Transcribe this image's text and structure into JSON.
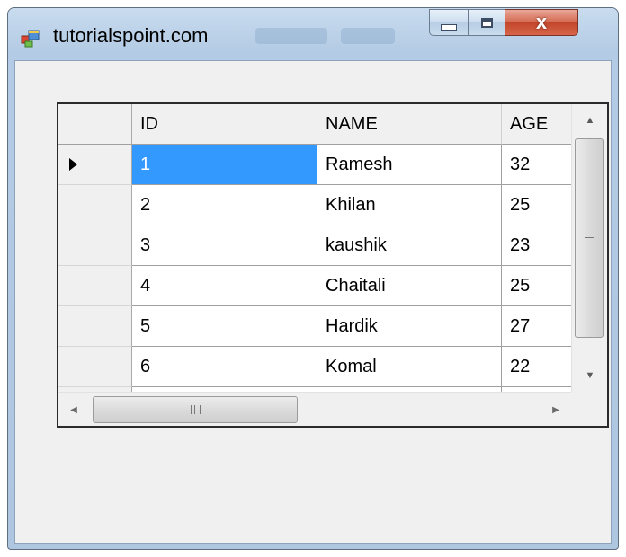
{
  "window": {
    "title": "tutorialspoint.com",
    "icon": "app-window-icon",
    "controls": {
      "minimize_icon": "minimize-icon",
      "maximize_icon": "maximize-icon",
      "close_glyph": "x"
    }
  },
  "grid": {
    "columns": [
      "ID",
      "NAME",
      "AGE"
    ],
    "selected_row": 0,
    "selection_color": "#3399ff",
    "current_row_indicator": "row-pointer-icon",
    "rows": [
      {
        "id": "1",
        "name": "Ramesh",
        "age": "32"
      },
      {
        "id": "2",
        "name": "Khilan",
        "age": "25"
      },
      {
        "id": "3",
        "name": "kaushik",
        "age": "23"
      },
      {
        "id": "4",
        "name": "Chaitali",
        "age": "25"
      },
      {
        "id": "5",
        "name": "Hardik",
        "age": "27"
      },
      {
        "id": "6",
        "name": "Komal",
        "age": "22"
      }
    ],
    "vscroll": {
      "up_arrow": "▲",
      "down_arrow": "▼",
      "grip": "≡"
    },
    "hscroll": {
      "left_arrow": "◀",
      "right_arrow": "▶",
      "grip": "III"
    }
  }
}
